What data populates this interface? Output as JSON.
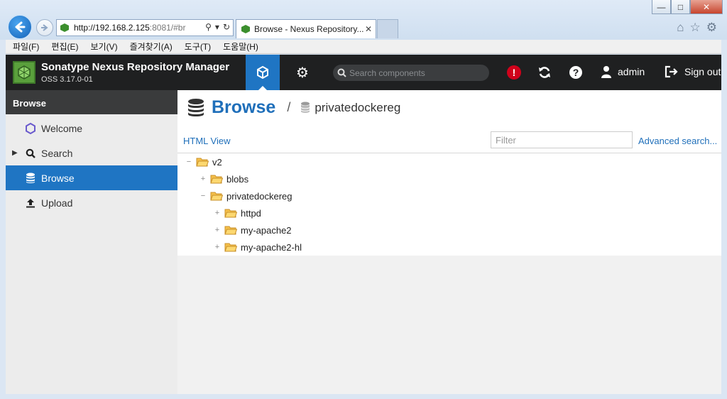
{
  "browser": {
    "url_host": "http://192.168.2.125",
    "url_rest": ":8081/#br",
    "tab_title": "Browse - Nexus Repository...",
    "menu": [
      "파일(F)",
      "편집(E)",
      "보기(V)",
      "즐겨찾기(A)",
      "도구(T)",
      "도움말(H)"
    ]
  },
  "app": {
    "title": "Sonatype Nexus Repository Manager",
    "version": "OSS 3.17.0-01",
    "search_placeholder": "Search components",
    "user": "admin",
    "sign_out": "Sign out"
  },
  "sidebar": {
    "header": "Browse",
    "items": [
      {
        "label": "Welcome",
        "icon": "hexagon-icon"
      },
      {
        "label": "Search",
        "icon": "search-icon"
      },
      {
        "label": "Browse",
        "icon": "database-icon"
      },
      {
        "label": "Upload",
        "icon": "upload-icon"
      }
    ]
  },
  "main": {
    "title": "Browse",
    "separator": "/",
    "repository": "privatedockereg",
    "html_view": "HTML View",
    "filter_placeholder": "Filter",
    "advanced_search": "Advanced search...",
    "tree": [
      {
        "label": "v2",
        "state": "expanded",
        "depth": 0
      },
      {
        "label": "blobs",
        "state": "collapsed",
        "depth": 1
      },
      {
        "label": "privatedockereg",
        "state": "expanded",
        "depth": 1
      },
      {
        "label": "httpd",
        "state": "collapsed",
        "depth": 2
      },
      {
        "label": "my-apache2",
        "state": "collapsed",
        "depth": 2
      },
      {
        "label": "my-apache2-hl",
        "state": "collapsed",
        "depth": 2
      }
    ]
  },
  "colors": {
    "accent": "#1f75c3",
    "topbar": "#1f2021",
    "alert": "#d0021b",
    "folder": "#f5c04a"
  }
}
